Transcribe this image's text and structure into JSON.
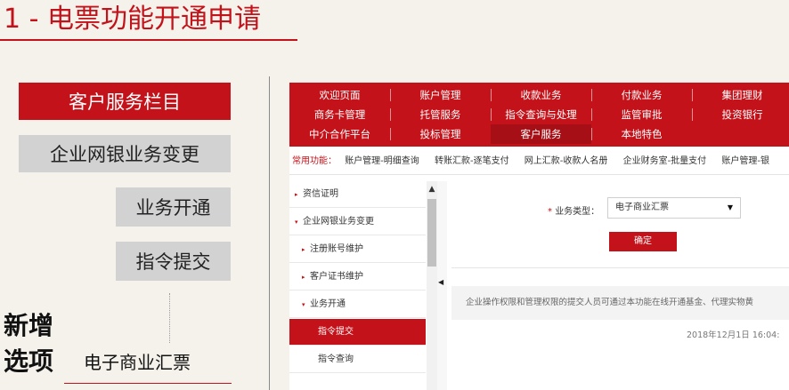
{
  "slide": {
    "title": "1 - 电票功能开通申请",
    "flow": [
      "客户服务栏目",
      "企业网银业务变更",
      "业务开通",
      "指令提交"
    ],
    "new_label_line1": "新增",
    "new_label_line2": "选项",
    "new_option": "电子商业汇票"
  },
  "nav": {
    "row1": [
      "欢迎页面",
      "账户管理",
      "收款业务",
      "付款业务",
      "集团理财"
    ],
    "row2": [
      "商务卡管理",
      "托管服务",
      "指令查询与处理",
      "监管审批",
      "投资银行"
    ],
    "row3": [
      "中介合作平台",
      "投标管理",
      "客户服务",
      "本地特色"
    ],
    "active": "客户服务"
  },
  "quickbar": {
    "label": "常用功能：",
    "items": [
      "账户管理-明细查询",
      "转账汇款-逐笔支付",
      "网上汇款-收款人名册",
      "企业财务室-批量支付",
      "账户管理-银"
    ]
  },
  "sidebar": {
    "items": [
      {
        "label": "资信证明",
        "marker": "▸"
      },
      {
        "label": "企业网银业务变更",
        "marker": "▾"
      },
      {
        "label": "注册账号维护",
        "marker": "▸"
      },
      {
        "label": "客户证书维护",
        "marker": "▸"
      },
      {
        "label": "业务开通",
        "marker": "▾"
      },
      {
        "label": "指令提交",
        "marker": ""
      },
      {
        "label": "指令查询",
        "marker": ""
      }
    ],
    "active_index": 5
  },
  "form": {
    "star": "*",
    "business_type_label": "业务类型：",
    "business_type_value": "电子商业汇票",
    "confirm_label": "确定"
  },
  "notice": "企业操作权限和管理权限的提交人员可通过本功能在线开通基金、代理实物黄",
  "date": "2018年12月1日 16:04:",
  "colors": {
    "brand_red": "#c3121a",
    "slide_bg": "#f5f2ec",
    "gray_box": "#d2d2d2"
  }
}
